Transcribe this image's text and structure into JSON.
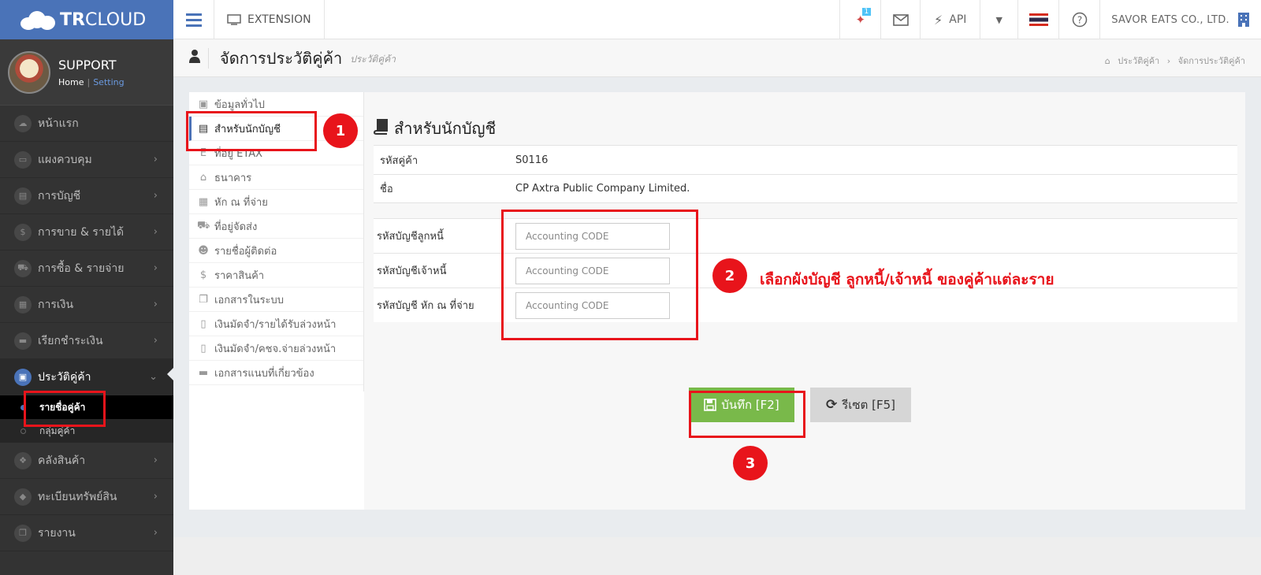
{
  "header": {
    "logo_bold": "TR",
    "logo_light": "CLOUD",
    "extension_label": "EXTENSION",
    "notification_count": "1",
    "api_label": "API",
    "company_name": "SAVOR EATS CO., LTD."
  },
  "profile": {
    "name": "SUPPORT",
    "home_link": "Home",
    "separator": "|",
    "setting_link": "Setting"
  },
  "sidebar": {
    "items": [
      {
        "label": "หน้าแรก",
        "chevron": ""
      },
      {
        "label": "แผงควบคุม",
        "chevron": "›"
      },
      {
        "label": "การบัญชี",
        "chevron": "›"
      },
      {
        "label": "การขาย & รายได้",
        "chevron": "›"
      },
      {
        "label": "การซื้อ & รายจ่าย",
        "chevron": "›"
      },
      {
        "label": "การเงิน",
        "chevron": "›"
      },
      {
        "label": "เรียกชำระเงิน",
        "chevron": "›"
      }
    ],
    "active": {
      "label": "ประวัติคู่ค้า",
      "chevron": "⌄"
    },
    "subitems": [
      {
        "label": "รายชื่อคู่ค้า"
      },
      {
        "label": "กลุ่มคู่ค้า"
      }
    ],
    "items_after": [
      {
        "label": "คลังสินค้า",
        "chevron": "›"
      },
      {
        "label": "ทะเบียนทรัพย์สิน",
        "chevron": "›"
      },
      {
        "label": "รายงาน",
        "chevron": "›"
      }
    ]
  },
  "page": {
    "title": "จัดการประวัติคู่ค้า",
    "subtitle": "ประวัติคู่ค้า",
    "breadcrumb": [
      "ประวัติคู่ค้า",
      "จัดการประวัติคู่ค้า"
    ],
    "breadcrumb_sep": "›"
  },
  "tabs": [
    {
      "label": "ข้อมูลทั่วไป",
      "icon": "▣"
    },
    {
      "label": "สำหรับนักบัญชี",
      "icon": "▤"
    },
    {
      "label": "ที่อยู่ ETAX",
      "icon": "E"
    },
    {
      "label": "ธนาคาร",
      "icon": "⌂"
    },
    {
      "label": "หัก ณ ที่จ่าย",
      "icon": "▦"
    },
    {
      "label": "ที่อยู่จัดส่ง",
      "icon": "⛟"
    },
    {
      "label": "รายชื่อผู้ติดต่อ",
      "icon": "☻"
    },
    {
      "label": "ราคาสินค้า",
      "icon": "$"
    },
    {
      "label": "เอกสารในระบบ",
      "icon": "❐"
    },
    {
      "label": "เงินมัดจำ/รายได้รับล่วงหน้า",
      "icon": "▯"
    },
    {
      "label": "เงินมัดจำ/คชจ.จ่ายล่วงหน้า",
      "icon": "▯"
    },
    {
      "label": "เอกสารแนบที่เกี่ยวข้อง",
      "icon": "▬"
    }
  ],
  "form": {
    "title": "สำหรับนักบัญชี",
    "info": [
      {
        "label": "รหัสคู่ค้า",
        "value": "S0116"
      },
      {
        "label": "ชื่อ",
        "value": "CP Axtra Public Company Limited."
      }
    ],
    "accounts": [
      {
        "label": "รหัสบัญชีลูกหนี้",
        "placeholder": "Accounting CODE"
      },
      {
        "label": "รหัสบัญชีเจ้าหนี้",
        "placeholder": "Accounting CODE"
      },
      {
        "label": "รหัสบัญชี หัก ณ ที่จ่าย",
        "placeholder": "Accounting CODE"
      }
    ],
    "save_label": "บันทึก [F2]",
    "reset_label": "รีเซต [F5]"
  },
  "annotations": {
    "step1": "1",
    "step2": "2",
    "step3": "3",
    "note": "เลือกผังบัญชี ลูกหนี้/เจ้าหนี้ ของคู่ค้าแต่ละราย"
  },
  "colors": {
    "brand": "#4a73b8",
    "annotation_red": "#e8141b",
    "save_green": "#79b94a",
    "sidebar_bg": "#333333"
  }
}
